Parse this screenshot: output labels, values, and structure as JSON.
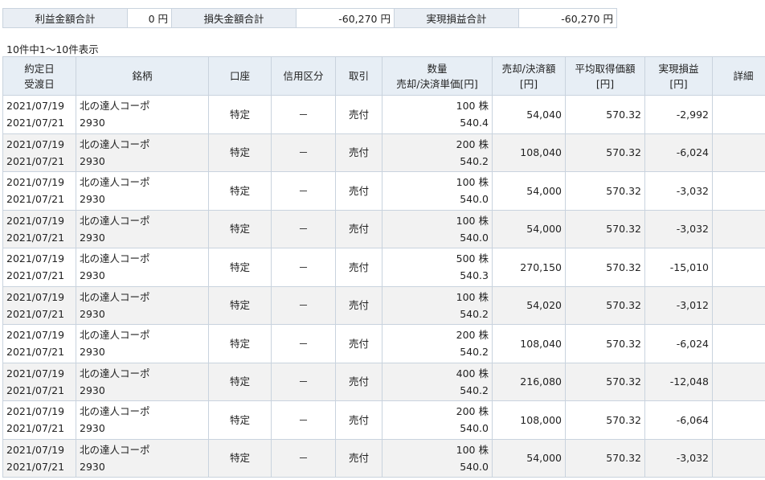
{
  "summary": {
    "profit_label": "利益金額合計",
    "profit_value": "0 円",
    "loss_label": "損失金額合計",
    "loss_value": "-60,270 円",
    "realized_label": "実現損益合計",
    "realized_value": "-60,270 円"
  },
  "count_text": "10件中1～10件表示",
  "headers": {
    "date1": "約定日",
    "date2": "受渡日",
    "name": "銘柄",
    "account": "口座",
    "credit": "信用区分",
    "trade": "取引",
    "qty1": "数量",
    "qty2": "売却/決済単価[円]",
    "amount1": "売却/決済額",
    "amount2": "[円]",
    "avg1": "平均取得価額",
    "avg2": "[円]",
    "pl1": "実現損益",
    "pl2": "[円]",
    "detail": "詳細"
  },
  "rows": [
    {
      "trade_date": "2021/07/19",
      "settle_date": "2021/07/21",
      "name": "北の達人コーポ",
      "code": "2930",
      "account": "特定",
      "credit": "－",
      "trade": "売付",
      "qty": "100 株",
      "price": "540.4",
      "amount": "54,040",
      "avg": "570.32",
      "pl": "-2,992"
    },
    {
      "trade_date": "2021/07/19",
      "settle_date": "2021/07/21",
      "name": "北の達人コーポ",
      "code": "2930",
      "account": "特定",
      "credit": "－",
      "trade": "売付",
      "qty": "200 株",
      "price": "540.2",
      "amount": "108,040",
      "avg": "570.32",
      "pl": "-6,024"
    },
    {
      "trade_date": "2021/07/19",
      "settle_date": "2021/07/21",
      "name": "北の達人コーポ",
      "code": "2930",
      "account": "特定",
      "credit": "－",
      "trade": "売付",
      "qty": "100 株",
      "price": "540.0",
      "amount": "54,000",
      "avg": "570.32",
      "pl": "-3,032"
    },
    {
      "trade_date": "2021/07/19",
      "settle_date": "2021/07/21",
      "name": "北の達人コーポ",
      "code": "2930",
      "account": "特定",
      "credit": "－",
      "trade": "売付",
      "qty": "100 株",
      "price": "540.0",
      "amount": "54,000",
      "avg": "570.32",
      "pl": "-3,032"
    },
    {
      "trade_date": "2021/07/19",
      "settle_date": "2021/07/21",
      "name": "北の達人コーポ",
      "code": "2930",
      "account": "特定",
      "credit": "－",
      "trade": "売付",
      "qty": "500 株",
      "price": "540.3",
      "amount": "270,150",
      "avg": "570.32",
      "pl": "-15,010"
    },
    {
      "trade_date": "2021/07/19",
      "settle_date": "2021/07/21",
      "name": "北の達人コーポ",
      "code": "2930",
      "account": "特定",
      "credit": "－",
      "trade": "売付",
      "qty": "100 株",
      "price": "540.2",
      "amount": "54,020",
      "avg": "570.32",
      "pl": "-3,012"
    },
    {
      "trade_date": "2021/07/19",
      "settle_date": "2021/07/21",
      "name": "北の達人コーポ",
      "code": "2930",
      "account": "特定",
      "credit": "－",
      "trade": "売付",
      "qty": "200 株",
      "price": "540.2",
      "amount": "108,040",
      "avg": "570.32",
      "pl": "-6,024"
    },
    {
      "trade_date": "2021/07/19",
      "settle_date": "2021/07/21",
      "name": "北の達人コーポ",
      "code": "2930",
      "account": "特定",
      "credit": "－",
      "trade": "売付",
      "qty": "400 株",
      "price": "540.2",
      "amount": "216,080",
      "avg": "570.32",
      "pl": "-12,048"
    },
    {
      "trade_date": "2021/07/19",
      "settle_date": "2021/07/21",
      "name": "北の達人コーポ",
      "code": "2930",
      "account": "特定",
      "credit": "－",
      "trade": "売付",
      "qty": "200 株",
      "price": "540.0",
      "amount": "108,000",
      "avg": "570.32",
      "pl": "-6,064"
    },
    {
      "trade_date": "2021/07/19",
      "settle_date": "2021/07/21",
      "name": "北の達人コーポ",
      "code": "2930",
      "account": "特定",
      "credit": "－",
      "trade": "売付",
      "qty": "100 株",
      "price": "540.0",
      "amount": "54,000",
      "avg": "570.32",
      "pl": "-3,032"
    }
  ]
}
